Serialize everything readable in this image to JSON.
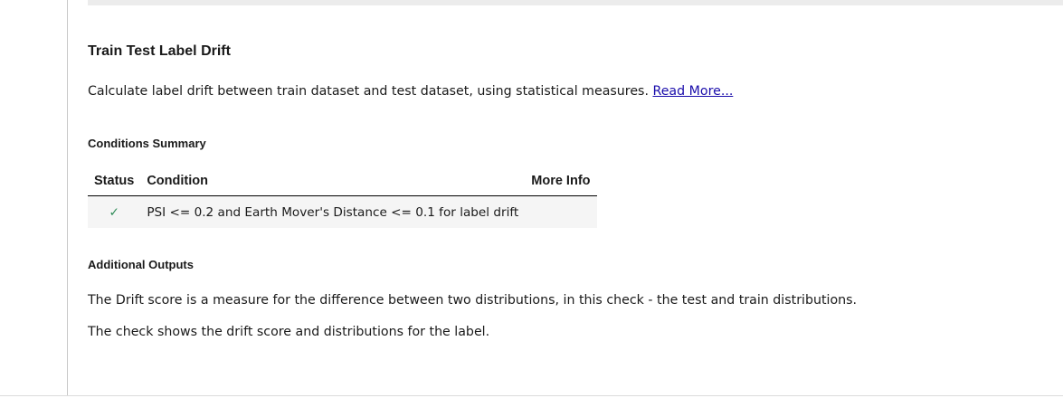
{
  "check": {
    "title": "Train Test Label Drift",
    "description": "Calculate label drift between train dataset and test dataset, using statistical measures.",
    "read_more_label": "Read More..."
  },
  "conditions_summary": {
    "heading": "Conditions Summary",
    "columns": {
      "status": "Status",
      "condition": "Condition",
      "more_info": "More Info"
    },
    "rows": [
      {
        "status_icon": "checkmark-icon",
        "status_glyph": "✓",
        "status_color": "#2e8b57",
        "condition": "PSI <= 0.2 and Earth Mover's Distance <= 0.1 for label drift",
        "more_info": ""
      }
    ]
  },
  "additional_outputs": {
    "heading": "Additional Outputs",
    "paragraphs": [
      "The Drift score is a measure for the difference between two distributions, in this check - the test and train distributions.",
      "The check shows the drift score and distributions for the label."
    ]
  },
  "colors": {
    "link": "#1a0dab",
    "success": "#2e8b57",
    "row_background": "#f5f5f5"
  }
}
